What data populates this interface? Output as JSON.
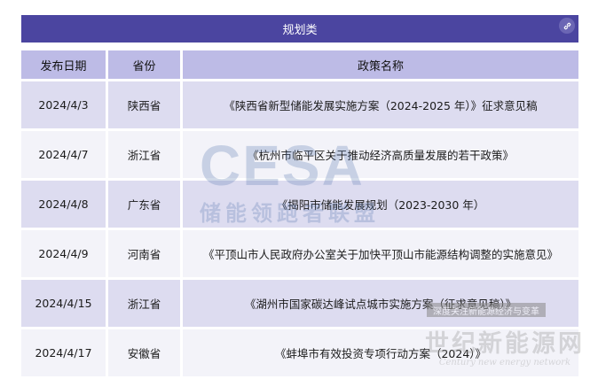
{
  "title": "规划类",
  "columns": [
    "发布日期",
    "省份",
    "政策名称"
  ],
  "rows": [
    {
      "date": "2024/4/3",
      "province": "陕西省",
      "policy": "《陕西省新型储能发展实施方案（2024-2025 年）》征求意见稿"
    },
    {
      "date": "2024/4/7",
      "province": "浙江省",
      "policy": "《杭州市临平区关于推动经济高质量发展的若干政策》"
    },
    {
      "date": "2024/4/8",
      "province": "广东省",
      "policy": "《揭阳市储能发展规划（2023-2030 年）"
    },
    {
      "date": "2024/4/9",
      "province": "河南省",
      "policy": "《平顶山市人民政府办公室关于加快平顶山市能源结构调整的实施意见》"
    },
    {
      "date": "2024/4/15",
      "province": "浙江省",
      "policy": "《湖州市国家碳达峰试点城市实施方案（征求意见稿）》"
    },
    {
      "date": "2024/4/17",
      "province": "安徽省",
      "policy": "《蚌埠市有效投资专项行动方案（2024）》"
    }
  ],
  "watermarks": {
    "logo": "CESA",
    "logo_sub": "储能领跑者联盟",
    "stamp": "深度关注新能源经济与变革",
    "brand_cn": "世纪新能源网",
    "brand_en": "Century new energy network"
  },
  "icons": {
    "link": "link-icon"
  },
  "colors": {
    "header": "#4b45a0",
    "col_header": "#bdbbe6",
    "row_odd": "#dddcf0",
    "row_even": "#f3f3f9"
  }
}
